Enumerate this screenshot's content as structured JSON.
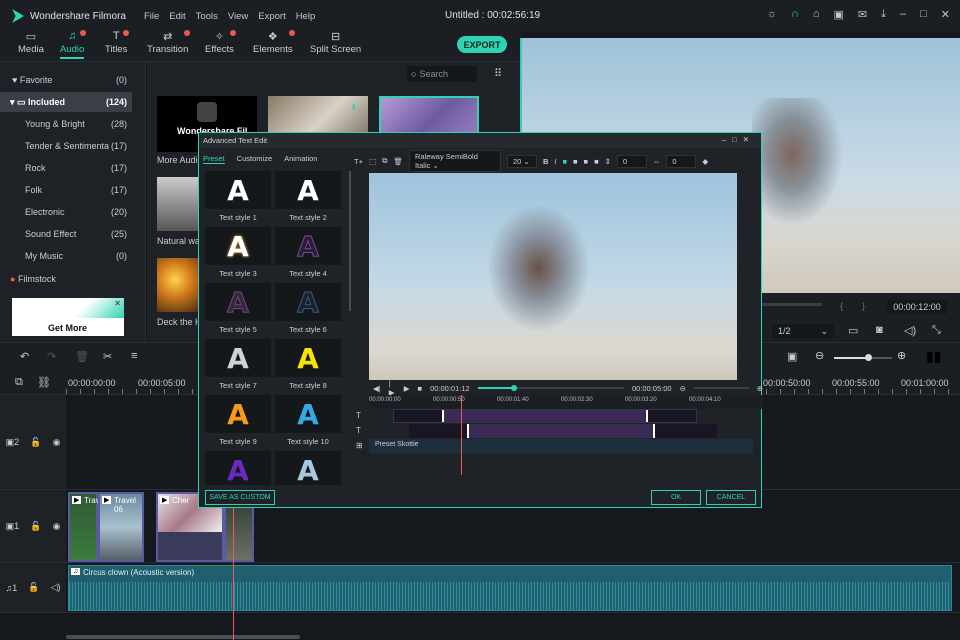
{
  "app": {
    "name": "Wondershare Filmora",
    "project_title": "Untitled : 00:02:56:19",
    "menu": [
      "File",
      "Edit",
      "Tools",
      "View",
      "Export",
      "Help"
    ]
  },
  "tabs": [
    {
      "label": "Media",
      "icon": "folder-icon"
    },
    {
      "label": "Audio",
      "icon": "music-icon"
    },
    {
      "label": "Titles",
      "icon": "text-icon"
    },
    {
      "label": "Transition",
      "icon": "transition-icon"
    },
    {
      "label": "Effects",
      "icon": "effects-icon"
    },
    {
      "label": "Elements",
      "icon": "elements-icon"
    },
    {
      "label": "Split Screen",
      "icon": "split-screen-icon"
    }
  ],
  "export_label": "EXPORT",
  "sidebar": {
    "items": [
      {
        "label": "Favorite",
        "count": "(0)"
      },
      {
        "label": "Included",
        "count": "(124)"
      },
      {
        "label": "Young & Bright",
        "count": "(28)"
      },
      {
        "label": "Tender & Sentimenta",
        "count": "(17)"
      },
      {
        "label": "Rock",
        "count": "(17)"
      },
      {
        "label": "Folk",
        "count": "(17)"
      },
      {
        "label": "Electronic",
        "count": "(20)"
      },
      {
        "label": "Sound Effect",
        "count": "(25)"
      },
      {
        "label": "My Music",
        "count": "(0)"
      }
    ],
    "filmstock": "Filmstock",
    "ad_label": "Get More"
  },
  "media": {
    "search_placeholder": "Search",
    "items": [
      "More Audio",
      "Natural wa",
      "Deck the H"
    ],
    "brand_thumb": "Wondershare Fil"
  },
  "preview": {
    "timecode": "00:00:12:00",
    "zoom": "1/2"
  },
  "timeline": {
    "ruler": [
      "00:00:00:00",
      "00:00:05:00",
      "00:00:50:00",
      "00:00:55:00",
      "00:01:00:00"
    ],
    "tracks": [
      "2",
      "1",
      "1"
    ],
    "clips": [
      "Trav",
      "Travel 06",
      "Cher"
    ],
    "audio_clip": "Circus clown (Acoustic version)"
  },
  "dialog": {
    "title": "Advanced Text Edit",
    "tabs": [
      "Preset",
      "Customize",
      "Animation"
    ],
    "font": "Raleway SemiBold Italic",
    "font_size": "20",
    "spacing1": "0",
    "spacing2": "0",
    "styles": [
      "Text style 1",
      "Text style 2",
      "Text style 3",
      "Text style 4",
      "Text style 5",
      "Text style 6",
      "Text style 7",
      "Text style 8",
      "Text style 9",
      "Text style 10"
    ],
    "style_glyph": "A",
    "current_time": "00:00:01:12",
    "duration": "00:00:05:00",
    "ruler": [
      "00:00:00:00",
      "00:00:00:50",
      "00:00:01:40",
      "00:00:02:30",
      "00:00:03:20",
      "00:00:04:10"
    ],
    "preset_track": "Preset Skottie",
    "save_custom": "SAVE AS CUSTOM",
    "ok": "OK",
    "cancel": "CANCEL"
  },
  "colors": {
    "accent": "#2fd3b3",
    "playhead": "#ef5a4b"
  }
}
